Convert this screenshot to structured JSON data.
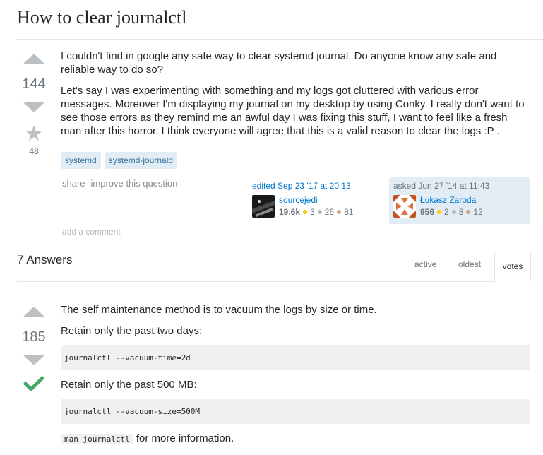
{
  "question": {
    "title": "How to clear journalctl",
    "votes": "144",
    "favorites": "48",
    "paragraphs": [
      "I couldn't find in google any safe way to clear systemd journal. Do anyone know any safe and reliable way to do so?",
      "Let's say I was experimenting with something and my logs got cluttered with various error messages. Moreover I'm displaying my journal on my desktop by using Conky. I really don't want to see those errors as they remind me an awful day I was fixing this stuff, I want to feel like a fresh man after this horror. I think everyone will agree that this is a valid reason to clear the logs :P ."
    ],
    "tags": [
      "systemd",
      "systemd-journald"
    ],
    "menu": {
      "share": "share",
      "improve": "improve this question"
    },
    "editor": {
      "action": "edited Sep 23 '17 at 20:13",
      "name": "sourcejedi",
      "rep": "19.6k",
      "gold": "3",
      "silver": "26",
      "bronze": "81"
    },
    "owner": {
      "action": "asked Jun 27 '14 at 11:43",
      "name": "Łukasz Zaroda",
      "rep": "956",
      "gold": "2",
      "silver": "8",
      "bronze": "12"
    },
    "add_comment": "add a comment"
  },
  "answers_header": "7 Answers",
  "tabs": {
    "active": "active",
    "oldest": "oldest",
    "votes": "votes"
  },
  "answer": {
    "votes": "185",
    "p1": "The self maintenance method is to vacuum the logs by size or time.",
    "p2": "Retain only the past two days:",
    "code1": "journalctl --vacuum-time=2d",
    "p3": "Retain only the past 500 MB:",
    "code2": "journalctl --vacuum-size=500M",
    "inline_code": "man journalctl",
    "p4_rest": " for more information."
  },
  "colors": {
    "link": "#0077cc",
    "tag_bg": "#e1ecf4",
    "accepted": "#48a868"
  }
}
